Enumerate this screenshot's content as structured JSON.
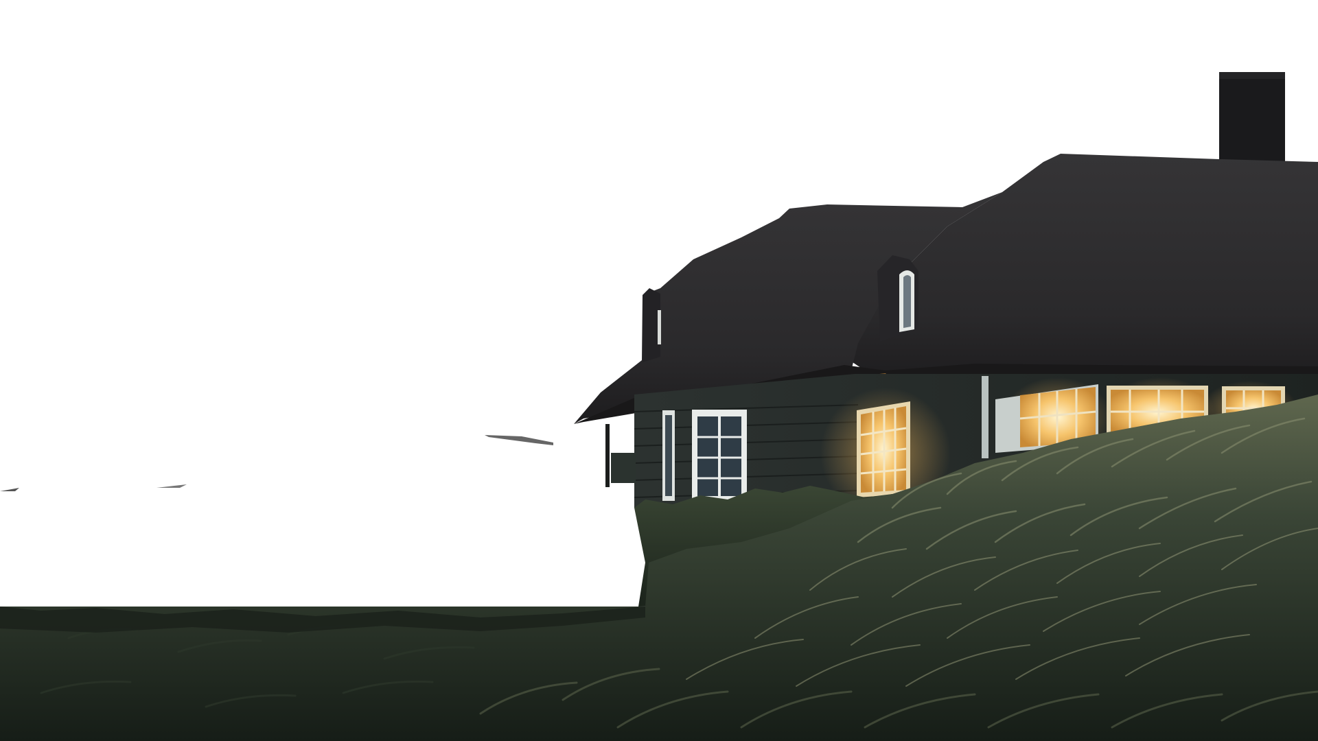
{
  "image": {
    "subject": "cutout-photo",
    "background_color": "#ffffff",
    "colors": {
      "sky_cutout": "#ffffff",
      "roof": "#2b2a2c",
      "roof_shadow": "#1d1c1e",
      "chimney": "#1a1a1c",
      "wall": "#262a28",
      "wall_plank": "#1c1f1e",
      "window_frame": "#e9ecea",
      "window_glow": "#f7c46a",
      "window_glow_bright": "#fff1c4",
      "window_dark": "#2e3a44",
      "grass_dark": "#141a15",
      "grass_mid": "#2f3a2c",
      "grass_light": "#7d8467",
      "hedge": "#263023"
    }
  }
}
